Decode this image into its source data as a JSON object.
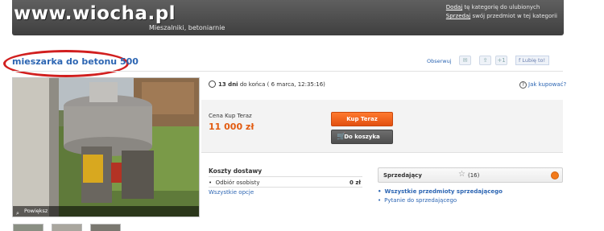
{
  "header": {
    "logo": "www.wiocha.pl",
    "category_label": "Mieszalniki, betoniarnie",
    "links": [
      {
        "link": "Dodaj",
        "text": "tę kategorię do ulubionych"
      },
      {
        "link": "Sprzedaj",
        "text": "swój przedmiot w tej kategorii"
      }
    ]
  },
  "listing": {
    "title": "mieszarka do betonu 500",
    "observe_label": "Obserwuj",
    "like_label": "Lubię to!",
    "gplus_label": "+1",
    "zoom_label": "Powiększ",
    "time_left_bold": "13 dni",
    "time_left_rest": "do końca ( 6 marca, 12:35:16)",
    "how_to_buy": "Jak kupować?"
  },
  "buy": {
    "label": "Cena Kup Teraz",
    "price": "11 000 zł",
    "buy_now_button": "Kup Teraz",
    "cart_button": "Do koszyka"
  },
  "shipping": {
    "title": "Koszty dostawy",
    "rows": [
      {
        "name": "Odbiór osobisty",
        "amount": "0 zł"
      }
    ],
    "all_options": "Wszystkie opcje"
  },
  "seller": {
    "label": "Sprzedający",
    "rating": "(16)",
    "links": [
      "Wszystkie przedmioty sprzedającego",
      "Pytanie do sprzedającego"
    ]
  },
  "colors": {
    "title_blue": "#2d66b3",
    "price_orange": "#e25b10",
    "highlight_red": "#d11f1f"
  }
}
